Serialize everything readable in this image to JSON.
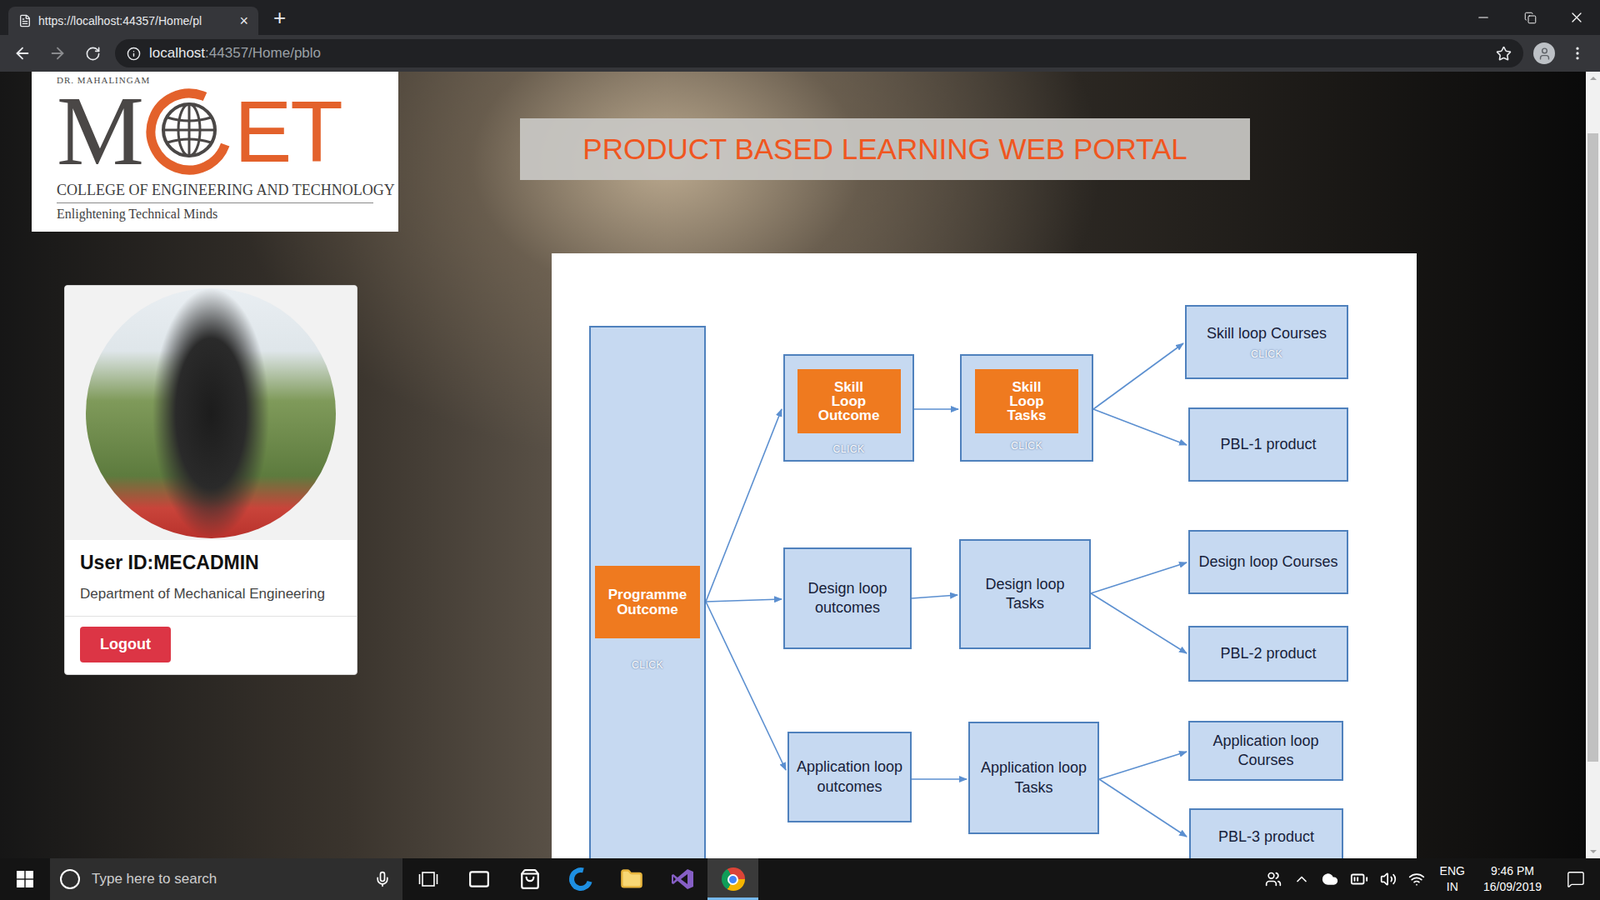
{
  "browser": {
    "tabs": [
      {
        "title": "https://localhost:44357/Home/pl",
        "close": "×",
        "selected": true
      }
    ],
    "new_tab": "+",
    "address": {
      "host": "localhost",
      "rest": ":44357/Home/pblo"
    },
    "forward_disabled": true
  },
  "page": {
    "logo": {
      "top": "DR. MAHALINGAM",
      "left": "M",
      "right": "ET",
      "college": "COLLEGE OF ENGINEERING AND TECHNOLOGY",
      "tagline": "Enlightening Technical Minds"
    },
    "title": "PRODUCT BASED LEARNING WEB PORTAL",
    "profile": {
      "user_id": "User ID:MECADMIN",
      "department": "Department of Mechanical Engineering",
      "logout": "Logout"
    },
    "diagram": {
      "nodes": [
        {
          "kind": "column",
          "label": "Programme Outcome",
          "highlighted": true,
          "click": "CLICK"
        },
        {
          "kind": "loop",
          "label": "Skill Loop Outcome",
          "highlighted": true,
          "click": "CLICK"
        },
        {
          "kind": "loop",
          "label": "Skill Loop Tasks",
          "highlighted": true,
          "click": "CLICK"
        },
        {
          "kind": "leaf",
          "label": "Skill loop Courses",
          "highlighted": false,
          "click": "CLICK"
        },
        {
          "kind": "leaf",
          "label": "PBL-1 product",
          "highlighted": false
        },
        {
          "kind": "loop",
          "label": "Design loop outcomes",
          "highlighted": false
        },
        {
          "kind": "loop",
          "label": "Design loop Tasks",
          "highlighted": false
        },
        {
          "kind": "leaf",
          "label": "Design loop Courses",
          "highlighted": false
        },
        {
          "kind": "leaf",
          "label": "PBL-2 product",
          "highlighted": false
        },
        {
          "kind": "loop",
          "label": "Application loop outcomes",
          "highlighted": false
        },
        {
          "kind": "loop",
          "label": "Application loop Tasks",
          "highlighted": false
        },
        {
          "kind": "leaf",
          "label": "Application loop Courses",
          "highlighted": false
        },
        {
          "kind": "leaf",
          "label": "PBL-3 product",
          "highlighted": false
        }
      ]
    }
  },
  "taskbar": {
    "search_placeholder": "Type here to search",
    "apps": [
      {
        "kind": "task-view",
        "selected": false
      },
      {
        "kind": "mail",
        "selected": false
      },
      {
        "kind": "store",
        "selected": false
      },
      {
        "kind": "edge",
        "selected": false
      },
      {
        "kind": "explorer",
        "selected": false
      },
      {
        "kind": "visual-studio",
        "selected": false
      },
      {
        "kind": "chrome",
        "selected": true
      }
    ],
    "language": [
      "ENG",
      "IN"
    ],
    "time": "9:46 PM",
    "date": "16/09/2019"
  }
}
